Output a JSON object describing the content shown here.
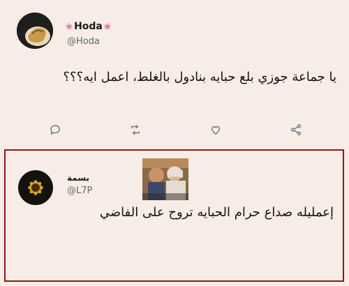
{
  "tweet": {
    "author_name": "Hoda",
    "name_decoration": "❀",
    "handle": "@Hoda",
    "text": "يا جماعة جوزي بلع حبايه بنادول بالغلط، اعمل ايه؟؟؟",
    "actions": [
      {
        "id": "reply",
        "icon": "comment-icon"
      },
      {
        "id": "retweet",
        "icon": "retweet-icon"
      },
      {
        "id": "like",
        "icon": "heart-icon"
      },
      {
        "id": "share",
        "icon": "share-icon"
      }
    ]
  },
  "reply": {
    "author_name": "بسمة",
    "handle": "@L7P",
    "text": "إعمليله صداع حرام الحبايه تروح على الفاضي"
  },
  "colors": {
    "background": "#f7ece6",
    "frame": "#8c1a14",
    "icon": "#6e7c88"
  }
}
